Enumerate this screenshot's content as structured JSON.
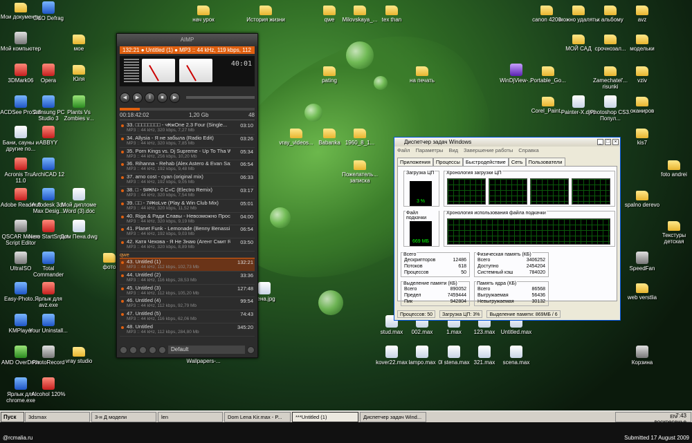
{
  "desktop_icons": [
    "Мои документы",
    "O&O Defrag",
    "нач урок",
    "История жизни",
    "qwe",
    "Milovskaya_...",
    "tex than",
    "canon 4200",
    "можно удалять",
    "к альбому",
    "avz",
    "Мой компьютер",
    "мое",
    "МОЙ САД",
    "срочнозал...",
    "модельки",
    "3DMark06",
    "Opera",
    "Юля",
    "pating",
    "на печать",
    "WinDjView-...",
    "Portable_Go...",
    "Zamechatel'... risunki",
    "vziv",
    "ACDSee Pro 2.5",
    "Samsung PC Studio 3",
    "Plants Vs Zombies v...",
    "Corel_Paint...",
    "Painter-X.djvu",
    "Photoshop CS3. Попул...",
    "оканиров",
    "Бани, сауны и другие по...",
    "ABBYY",
    "vray_videos...",
    "Babanka",
    "1960_8_1...",
    "kis7",
    "Acronis Tru... 11.0",
    "ArchiCAD 12",
    "Пожелатель... записка",
    "foto andrei",
    "Adobe Reader 8",
    "Autodesk 3ds Max Desig...",
    "Мой дипломе Word (3).doc",
    "spalno derevo",
    "QSCAR Mouse Script Editor",
    "Nero StartSmart",
    "Дом Пена.dwg",
    "Текстуры детская",
    "UltraISO",
    "Total Commander",
    "фото",
    "SpeedFan",
    "Easy-Photo...",
    "Ярлык для avz.exe",
    "Лена.jpg",
    "web verstlia",
    "KMPlayer",
    "Your Uninstall...",
    "stud.max",
    "002.max",
    "1.max",
    "123.max",
    "Untitled.max",
    "AMD OverDrive",
    "PhotoRecord",
    "vray studio",
    "Wallpapers-...",
    "kover22.max",
    "lampo.max",
    "0l stena.max",
    "321.max",
    "scena.max",
    "Корзина",
    "Ярлык для chrome.exe",
    "Alcohol 120%"
  ],
  "aimp": {
    "title": "AIMP",
    "ticker": "132:21 ● Untitled (1) ● MP3 :: 44 kHz, 119 kbps, 112",
    "clock": "40:01",
    "info_time": "00:18:42:02",
    "info_size": "1,20 Gb",
    "info_count": "48",
    "group_label": "qwe",
    "preset": "Default",
    "tracks": [
      {
        "title": "33. □□□□□□□□ - ч₭жOne 2.3 Four (Single...",
        "meta": "MP3 :: 44 kHz, 320 kbps, 7,27 Mb",
        "dur": "03:10"
      },
      {
        "title": "34. Allysia - Я не забыла (Radio Edit)",
        "meta": "MP3 :: 44 kHz, 320 kbps, 7,85 Mb",
        "dur": "03:26"
      },
      {
        "title": "35. Porn Kings vs. Dj Supreme - Up To Tha Wild...",
        "meta": "MP3 :: 44 kHz, 256 kbps, 10,20 Mb",
        "dur": "05:34"
      },
      {
        "title": "36. Rihanna - Rehab (Alex Astero & Evan Sax ...",
        "meta": "MP3 :: 44 kHz, 192 kbps, 9,48 Mb",
        "dur": "06:54"
      },
      {
        "title": "37. arno cost - cyan (original mix)",
        "meta": "MP3 :: 44 kHz, 192 kbps, 9,05 Mb",
        "dur": "06:33"
      },
      {
        "title": "38. □ - 9#₭N> 0 С«С (Electro Remix)",
        "meta": "MP3 :: 44 kHz, 320 kbps, 7,54 Mb",
        "dur": "03:17"
      },
      {
        "title": "39. □□ - 7#₭oLve (Play & Win Club Mix)",
        "meta": "MP3 :: 44 kHz, 320 kbps, 11,52 Mb",
        "dur": "05:01"
      },
      {
        "title": "40. Riga & Ради Славы - Невозможно Просто",
        "meta": "MP3 :: 44 kHz, 320 kbps, 9,19 Mb",
        "dur": "04:00"
      },
      {
        "title": "41. Planet Funk - Lemonade (Benny Benassi remix)",
        "meta": "MP3 :: 44 kHz, 192 kbps, 9,03 Mb",
        "dur": "06:54"
      },
      {
        "title": "42. Катя Чехова - Я Не Знаю (Агент Смит Ra...",
        "meta": "MP3 :: 44 kHz, 320 kbps, 8,89 Mb",
        "dur": "03:50"
      },
      {
        "title": "43. Untitled (1)",
        "meta": "MP3 :: 44 kHz, 112 kbps, 102,73 Mb",
        "dur": "132:21",
        "playing": true
      },
      {
        "title": "44. Untitled (2)",
        "meta": "MP3 :: 44 kHz, 116 kbps, 28,53 Mb",
        "dur": "33:36"
      },
      {
        "title": "45. Untitled (3)",
        "meta": "MP3 :: 44 kHz, 112 kbps, 105,20 Mb",
        "dur": "127:48"
      },
      {
        "title": "46. Untitled (4)",
        "meta": "MP3 :: 44 kHz, 112 kbps, 92,79 Mb",
        "dur": "99:54"
      },
      {
        "title": "47. Untitled (5)",
        "meta": "MP3 :: 44 kHz, 116 kbps, 62,06 Mb",
        "dur": "74:43"
      },
      {
        "title": "48. Untitled",
        "meta": "MP3 :: 44 kHz, 112 kbps, 284,80 Mb",
        "dur": "345:20"
      }
    ]
  },
  "taskmgr": {
    "title": "Диспетчер задач Windows",
    "menu": [
      "Файл",
      "Параметры",
      "Вид",
      "Завершение работы",
      "Справка"
    ],
    "tabs": [
      "Приложения",
      "Процессы",
      "Быстродействие",
      "Сеть",
      "Пользователи"
    ],
    "cpu_label": "Загрузка ЦП",
    "cpu_value": "3 %",
    "cpu_history_label": "Хронология загрузки ЦП",
    "pf_label": "Файл подкачки",
    "pf_value": "669 МБ",
    "pf_history_label": "Хронология использования файла подкачки",
    "totals": {
      "label": "Всего",
      "rows": [
        [
          "Дескрипторов",
          "12486"
        ],
        [
          "Потоков",
          "618"
        ],
        [
          "Процессов",
          "50"
        ]
      ]
    },
    "physical": {
      "label": "Физическая память (КБ)",
      "rows": [
        [
          "Всего",
          "3406252"
        ],
        [
          "Доступно",
          "2454204"
        ],
        [
          "Системный кэш",
          "784020"
        ]
      ]
    },
    "commit": {
      "label": "Выделение памяти (КБ)",
      "rows": [
        [
          "Всего",
          "890052"
        ],
        [
          "Предел",
          "7459444"
        ],
        [
          "Пик",
          "942804"
        ]
      ]
    },
    "kernel": {
      "label": "Память ядра (КБ)",
      "rows": [
        [
          "Всего",
          "86568"
        ],
        [
          "Выгружаемая",
          "56436"
        ],
        [
          "Невыгружаемая",
          "30132"
        ]
      ]
    },
    "status": [
      "Процессов: 50",
      "Загрузка ЦП: 3%",
      "Выделение памяти: 869МБ / 6"
    ]
  },
  "taskbar": {
    "start": "Пуск",
    "items": [
      "3dsmax",
      "3-н Д модели",
      "len",
      "Dom Lena Kir.max - P...",
      "***Untitled (1)",
      "Диспетчер задач Wind..."
    ],
    "time": "7:43",
    "day": "воскресенье",
    "lang": "EN"
  },
  "footer": {
    "logo": "@rcmalia.ru",
    "submitted": "Submitted 17 August 2009"
  },
  "colors": {
    "accent": "#e06010",
    "tm_border": "#0054e3"
  }
}
